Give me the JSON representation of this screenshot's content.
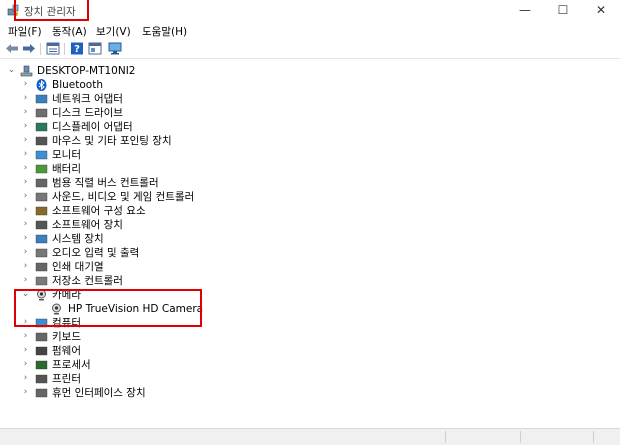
{
  "window": {
    "title": "장치 관리자",
    "controls": {
      "minimize": "—",
      "maximize": "☐",
      "close": "✕"
    }
  },
  "menu": [
    "파일(F)",
    "동작(A)",
    "보기(V)",
    "도움말(H)"
  ],
  "toolbar": [
    "back-arrow-icon",
    "forward-arrow-icon",
    "properties-view-icon",
    "help-icon",
    "update-view-icon",
    "monitor-icon"
  ],
  "tree": {
    "root": "DESKTOP-MT10NI2",
    "categories": [
      {
        "label": "Bluetooth",
        "icon": "bluetooth-icon"
      },
      {
        "label": "네트워크 어댑터",
        "icon": "network-adapter-icon"
      },
      {
        "label": "디스크 드라이브",
        "icon": "disk-drive-icon"
      },
      {
        "label": "디스플레이 어댑터",
        "icon": "display-adapter-icon"
      },
      {
        "label": "마우스 및 기타 포인팅 장치",
        "icon": "mouse-icon"
      },
      {
        "label": "모니터",
        "icon": "monitor-icon"
      },
      {
        "label": "배터리",
        "icon": "battery-icon"
      },
      {
        "label": "범용 직렬 버스 컨트롤러",
        "icon": "usb-controller-icon"
      },
      {
        "label": "사운드, 비디오 및 게임 컨트롤러",
        "icon": "sound-icon"
      },
      {
        "label": "소프트웨어 구성 요소",
        "icon": "software-component-icon"
      },
      {
        "label": "소프트웨어 장치",
        "icon": "software-device-icon"
      },
      {
        "label": "시스템 장치",
        "icon": "system-device-icon"
      },
      {
        "label": "오디오 입력 및 출력",
        "icon": "audio-io-icon"
      },
      {
        "label": "인쇄 대기열",
        "icon": "print-queue-icon"
      },
      {
        "label": "저장소 컨트롤러",
        "icon": "storage-controller-icon"
      },
      {
        "label": "카메라",
        "icon": "camera-icon",
        "expanded": true,
        "children": [
          "HP TrueVision HD Camera"
        ]
      },
      {
        "label": "컴퓨터",
        "icon": "computer-icon"
      },
      {
        "label": "키보드",
        "icon": "keyboard-icon"
      },
      {
        "label": "펌웨어",
        "icon": "firmware-icon"
      },
      {
        "label": "프로세서",
        "icon": "processor-icon"
      },
      {
        "label": "프린터",
        "icon": "printer-icon"
      },
      {
        "label": "휴먼 인터페이스 장치",
        "icon": "hid-icon"
      }
    ]
  },
  "colors": {
    "highlight": "#e00000",
    "accent": "#0078d7"
  }
}
